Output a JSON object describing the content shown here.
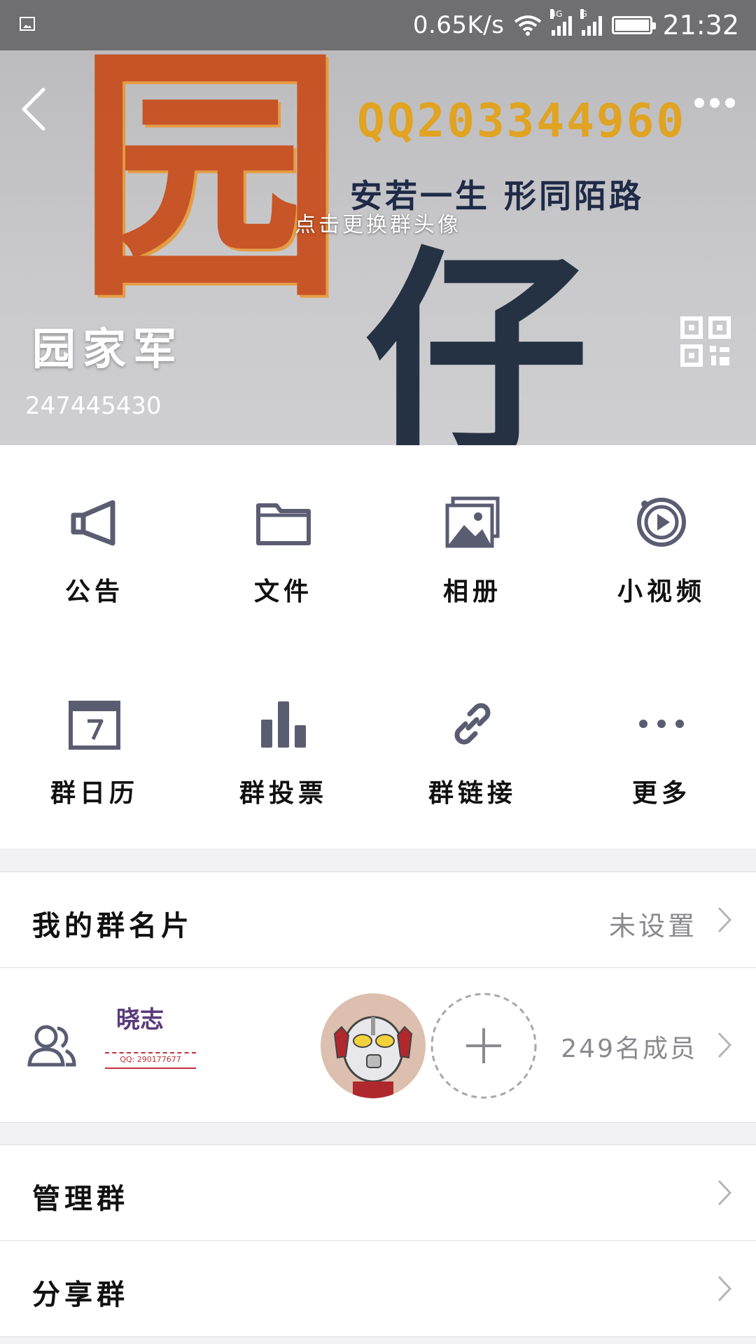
{
  "status_bar": {
    "speed": "0.65K/s",
    "network_1": "4G",
    "network_2": "G",
    "time": "21:32"
  },
  "header": {
    "art_qq_text": "QQ203344960",
    "art_slogan": "安若一生 形同陌路",
    "art_char_top": "园",
    "art_char_bottom": "仔",
    "change_avatar_hint": "点击更换群头像",
    "group_name": "园家军",
    "group_id": "247445430"
  },
  "features": [
    {
      "label": "公告",
      "icon": "megaphone-icon"
    },
    {
      "label": "文件",
      "icon": "folder-icon"
    },
    {
      "label": "相册",
      "icon": "album-icon"
    },
    {
      "label": "小视频",
      "icon": "video-icon"
    },
    {
      "label": "群日历",
      "icon": "calendar-icon"
    },
    {
      "label": "群投票",
      "icon": "vote-icon"
    },
    {
      "label": "群链接",
      "icon": "link-icon"
    },
    {
      "label": "更多",
      "icon": "more-icon"
    }
  ],
  "card_row": {
    "title": "我的群名片",
    "value": "未设置"
  },
  "members_row": {
    "member_1_text": "晓志",
    "member_1_sub": "QQ: 290177677",
    "count": "249名成员"
  },
  "manage_row": {
    "title": "管理群"
  },
  "share_row": {
    "title": "分享群"
  },
  "colors": {
    "icon": "#5a5d72",
    "header_bg": "#c9c9cb",
    "status_bar": "#6f6f71",
    "art_orange": "#c84c1a",
    "art_gold": "#e0a322"
  }
}
